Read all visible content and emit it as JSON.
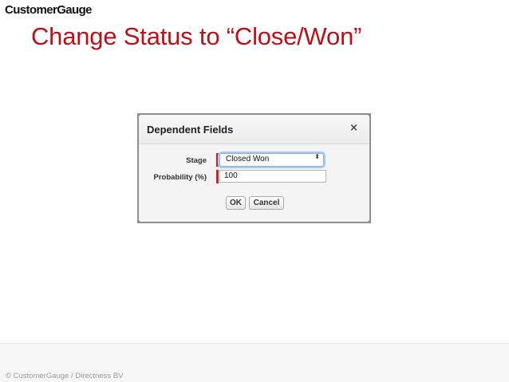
{
  "brand": {
    "logo_text": "CustomerGauge"
  },
  "slide": {
    "title": "Change Status to “Close/Won”"
  },
  "dialog": {
    "title": "Dependent Fields",
    "close_glyph": "×",
    "close_icon": "close-icon",
    "fields": {
      "stage": {
        "label": "Stage",
        "value": "Closed Won",
        "arrow_glyph": "⬍",
        "required": true
      },
      "probability": {
        "label": "Probability (%)",
        "value": "100",
        "required": true
      }
    },
    "buttons": {
      "ok_label": "OK",
      "cancel_label": "Cancel"
    }
  },
  "footer": {
    "copyright": "© CustomerGauge / Directness BV"
  },
  "colors": {
    "title_red": "#b3131b",
    "required_red": "#c0262d",
    "focus_blue": "#a9c8f0"
  }
}
